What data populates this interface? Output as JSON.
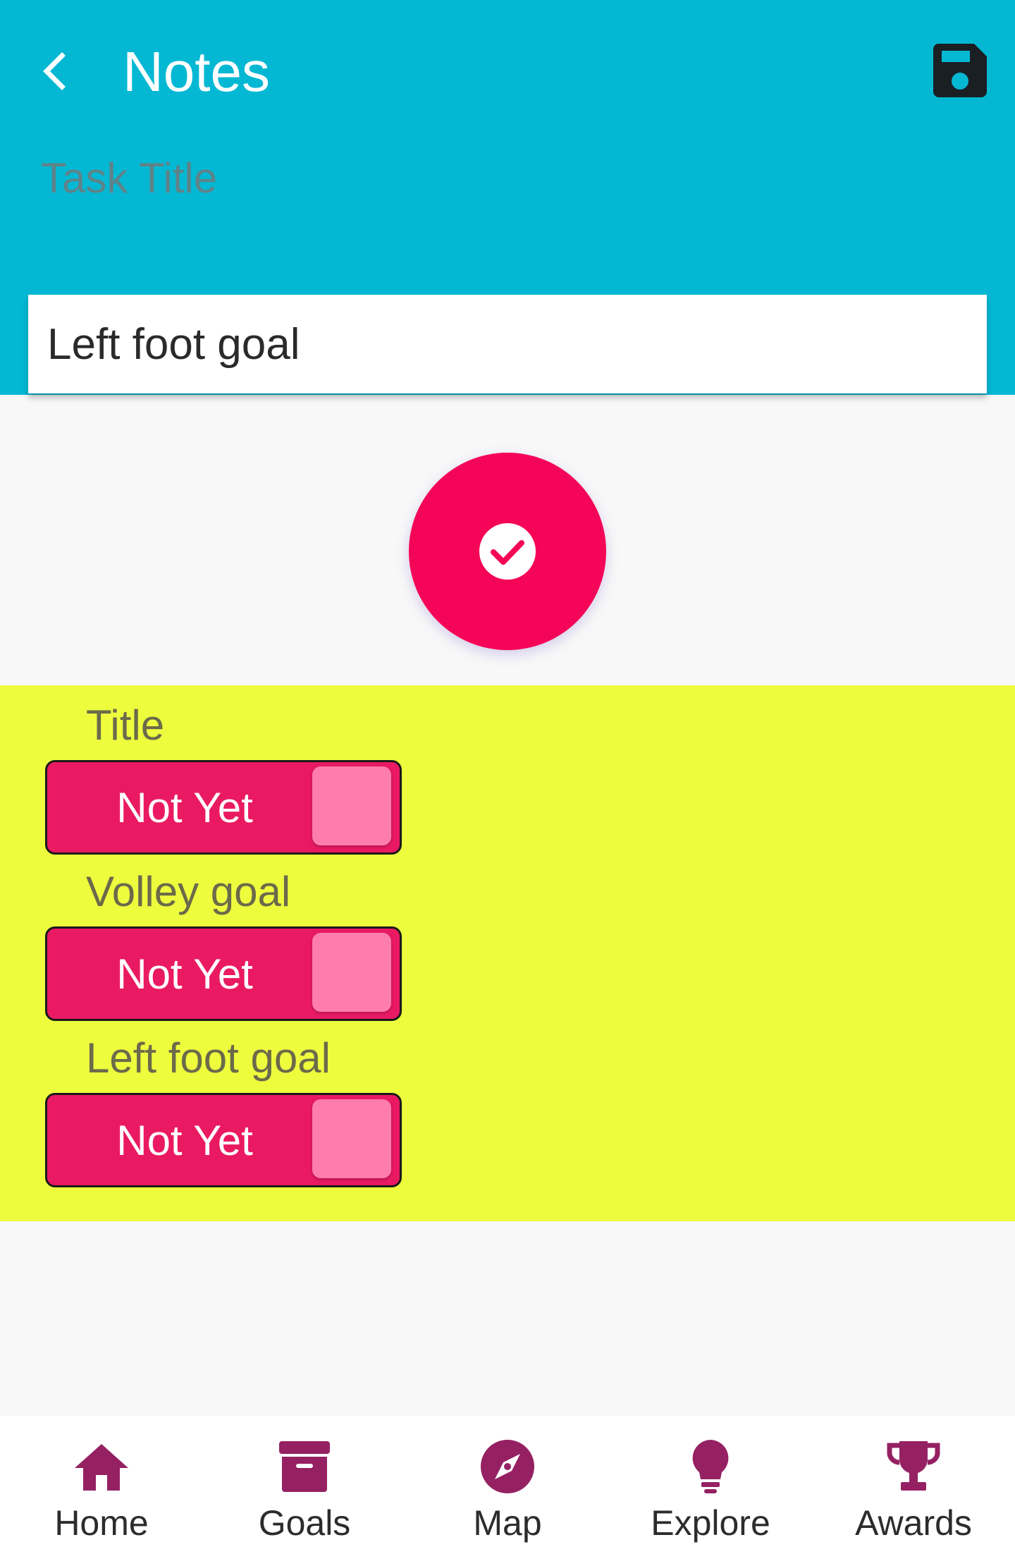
{
  "app_bar": {
    "title": "Notes",
    "back_icon": "chevron-left-icon",
    "save_icon": "save-icon",
    "background_color": "#04b8d4"
  },
  "task": {
    "label": "Task Title",
    "value": "Left foot goal"
  },
  "complete_button": {
    "icon": "check-circle-icon",
    "color": "#f50557"
  },
  "goals": {
    "background_color": "#eefc3e",
    "items": [
      {
        "label": "Title",
        "status": "Not Yet"
      },
      {
        "label": "Volley goal",
        "status": "Not Yet"
      },
      {
        "label": "Left foot goal",
        "status": "Not Yet"
      }
    ]
  },
  "bottom_nav": {
    "accent_color": "#952163",
    "items": [
      {
        "label": "Home",
        "icon": "home-icon"
      },
      {
        "label": "Goals",
        "icon": "archive-icon"
      },
      {
        "label": "Map",
        "icon": "compass-icon"
      },
      {
        "label": "Explore",
        "icon": "lightbulb-icon"
      },
      {
        "label": "Awards",
        "icon": "trophy-icon"
      }
    ]
  }
}
